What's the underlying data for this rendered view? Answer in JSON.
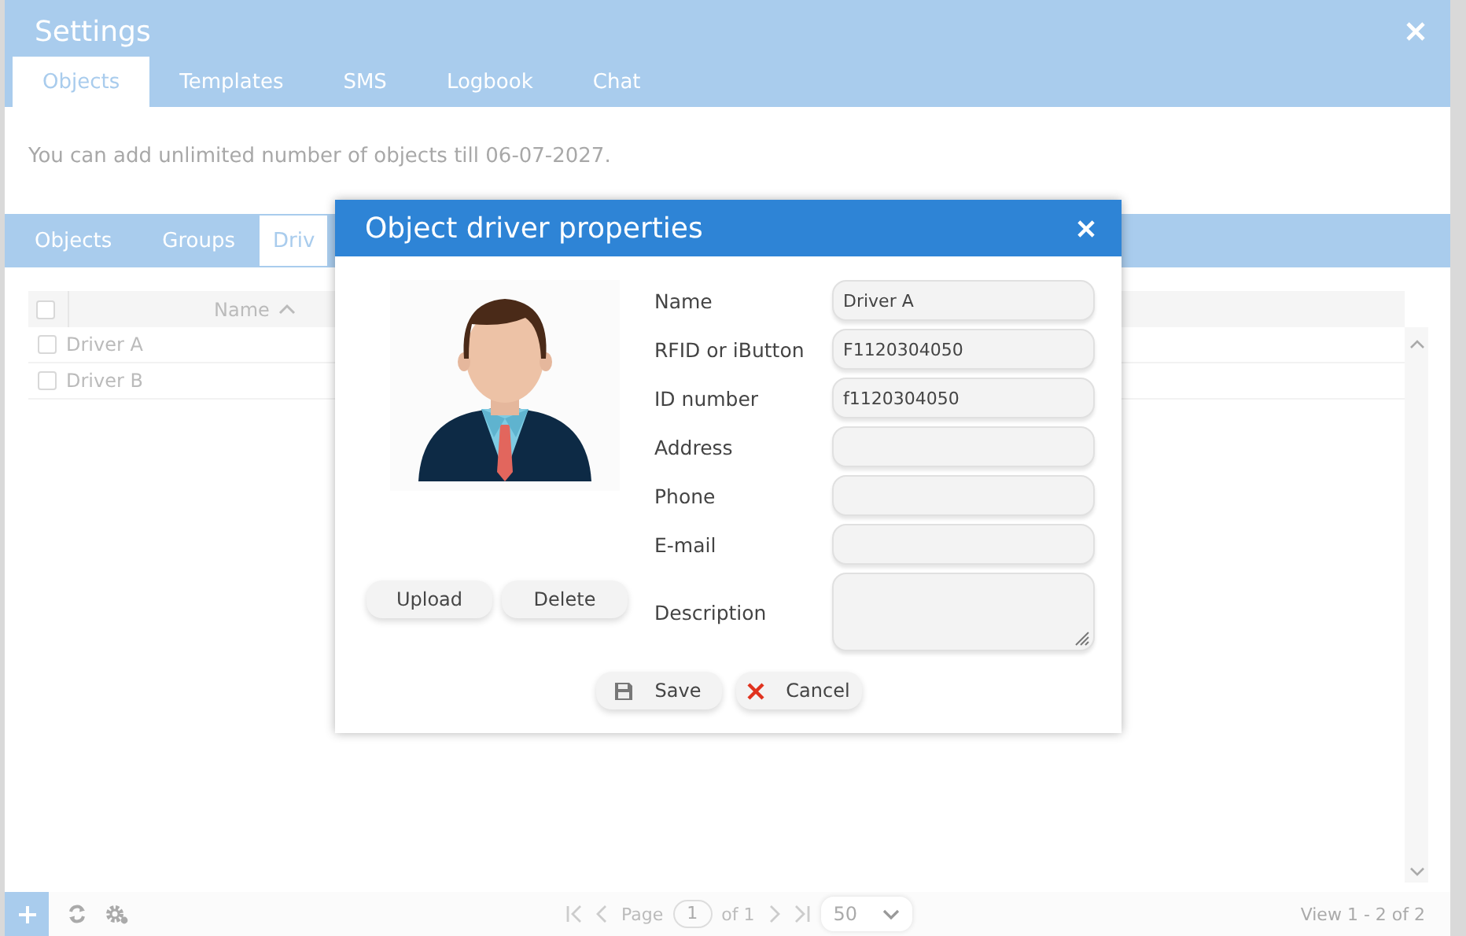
{
  "window": {
    "title": "Settings"
  },
  "tabs": [
    {
      "label": "Objects",
      "selected": true
    },
    {
      "label": "Templates",
      "selected": false
    },
    {
      "label": "SMS",
      "selected": false
    },
    {
      "label": "Logbook",
      "selected": false
    },
    {
      "label": "Chat",
      "selected": false
    }
  ],
  "notice": "You can add unlimited number of objects till 06-07-2027.",
  "subtabs": [
    {
      "label": "Objects",
      "selected": false
    },
    {
      "label": "Groups",
      "selected": false
    },
    {
      "label": "Driv",
      "selected": true
    }
  ],
  "grid": {
    "select_all_checked": false,
    "columns": [
      {
        "label": "Name"
      }
    ],
    "rows": [
      {
        "name": "Driver A",
        "checked": false
      },
      {
        "name": "Driver B",
        "checked": false
      }
    ]
  },
  "footer": {
    "page_label": "Page",
    "page": "1",
    "page_of": "of 1",
    "page_size": "50",
    "view": "View 1 - 2 of 2"
  },
  "dialog": {
    "title": "Object driver properties",
    "photo_buttons": [
      "Upload",
      "Delete"
    ],
    "fields": [
      {
        "label": "Name",
        "value": "Driver A",
        "kind": "input"
      },
      {
        "label": "RFID or iButton",
        "value": "F1120304050",
        "kind": "input"
      },
      {
        "label": "ID number",
        "value": "f1120304050",
        "kind": "input"
      },
      {
        "label": "Address",
        "kind": "input"
      },
      {
        "label": "Phone",
        "kind": "input"
      },
      {
        "label": "E-mail",
        "kind": "input"
      },
      {
        "label": "Description",
        "kind": "textarea"
      }
    ],
    "actions": [
      {
        "label": "Save",
        "kind": "save"
      },
      {
        "label": "Cancel",
        "kind": "cancel"
      }
    ]
  }
}
